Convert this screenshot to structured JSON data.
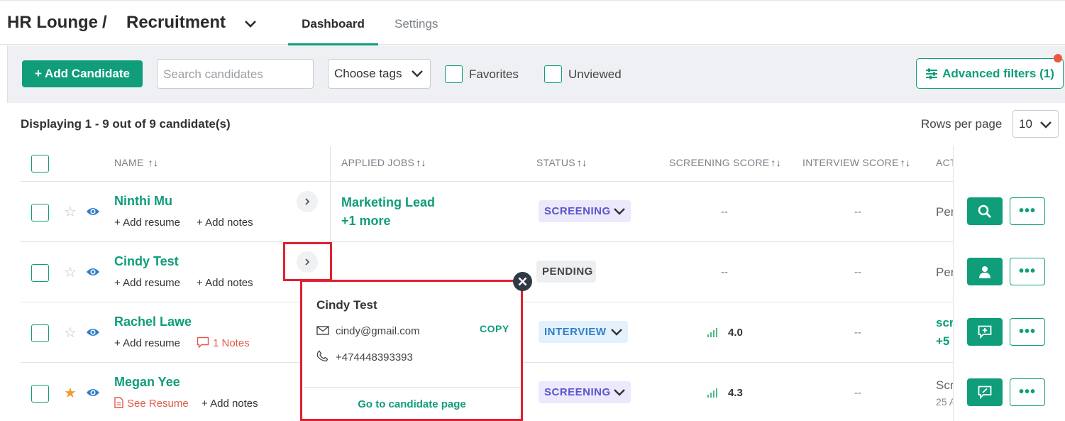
{
  "breadcrumb": {
    "org": "HR Lounge",
    "separator": "/",
    "section": "Recruitment"
  },
  "tabs": [
    {
      "label": "Dashboard"
    },
    {
      "label": "Settings"
    }
  ],
  "toolbar": {
    "add_label": "+ Add Candidate",
    "search_placeholder": "Search candidates",
    "tags_label": "Choose tags",
    "favorites_label": "Favorites",
    "unviewed_label": "Unviewed",
    "advanced_filters_label": "Advanced filters (1)"
  },
  "summary": {
    "displaying": "Displaying 1 - 9 out of 9 candidate(s)",
    "rows_per_page_label": "Rows per page",
    "rows_per_page_value": "10"
  },
  "columns": {
    "name": "NAME",
    "applied_jobs": "APPLIED JOBS",
    "status": "STATUS",
    "screening_score": "SCREENING SCORE",
    "interview_score": "INTERVIEW SCORE",
    "actions": "ACT"
  },
  "rows": [
    {
      "name": "Ninthi Mu",
      "resume": "+ Add resume",
      "notes": "+ Add notes",
      "job": "Marketing Lead",
      "job_more": "+1 more",
      "status": "SCREENING",
      "screening": "--",
      "interview": "--",
      "activity": "Pen",
      "favorite": false
    },
    {
      "name": "Cindy Test",
      "resume": "+ Add resume",
      "notes": "+ Add notes",
      "job": "",
      "job_more": "",
      "status": "PENDING",
      "screening": "--",
      "interview": "--",
      "activity": "Pen",
      "favorite": false
    },
    {
      "name": "Rachel Lawe",
      "resume": "+ Add resume",
      "notes": "1 Notes",
      "job": "",
      "job_more": "",
      "status": "INTERVIEW",
      "screening": "4.0",
      "interview": "--",
      "activity": "scr",
      "activity2": "+5",
      "favorite": false
    },
    {
      "name": "Megan Yee",
      "resume": "See Resume",
      "notes": "+ Add notes",
      "job": "",
      "job_more": "",
      "status": "SCREENING",
      "screening": "4.3",
      "interview": "--",
      "activity": "Scr",
      "activity2": "25 A",
      "favorite": true
    }
  ],
  "popup": {
    "name": "Cindy Test",
    "email": "cindy@gmail.com",
    "phone": "+474448393393",
    "copy_label": "COPY",
    "link_label": "Go to candidate page"
  },
  "colors": {
    "accent": "#0f9d7a",
    "highlight": "#e02030"
  }
}
